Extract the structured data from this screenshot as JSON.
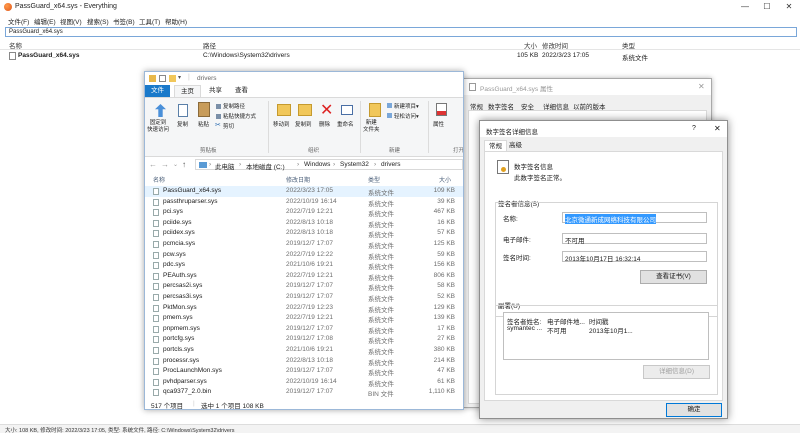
{
  "everything": {
    "title": "PassGuard_x64.sys - Everything",
    "menu": [
      "文件(F)",
      "编辑(E)",
      "视图(V)",
      "搜索(S)",
      "书签(B)",
      "工具(T)",
      "帮助(H)"
    ],
    "search_value": "PassGuard_x64.sys",
    "columns": [
      "名称",
      "路径",
      "大小",
      "修改时间",
      "类型"
    ],
    "result": {
      "name": "PassGuard_x64.sys",
      "path": "C:\\Windows\\System32\\drivers",
      "size": "105 KB",
      "modified": "2022/3/23 17:05",
      "type": "系统文件"
    },
    "status": "大小: 108 KB, 修改时间: 2022/3/23 17:05, 类型: 系统文件, 路径: C:\\Windows\\System32\\drivers"
  },
  "explorer": {
    "title": "drivers",
    "tabs": [
      "文件",
      "主页",
      "共享",
      "查看"
    ],
    "ribbon": {
      "pin": "固定到\n快速访问",
      "copy": "复制",
      "paste": "粘贴",
      "copy_path": "复制路径",
      "paste_shortcut": "粘贴快捷方式",
      "cut": "剪切",
      "clipboard_group": "剪贴板",
      "move_to": "移动到",
      "copy_to": "复制到",
      "delete": "删除",
      "rename": "重命名",
      "organize_group": "组织",
      "new_item": "新建项目▾",
      "easy_access": "轻松访问▾",
      "new_folder": "新建\n文件夹",
      "new_group": "新建",
      "properties": "属性",
      "open_group": "打开"
    },
    "breadcrumbs": [
      "此电脑",
      "本地磁盘 (C:)",
      "Windows",
      "System32",
      "drivers"
    ],
    "list_headers": [
      "名称",
      "修改日期",
      "类型",
      "大小"
    ],
    "files": [
      {
        "name": "PassGuard_x64.sys",
        "date": "2022/3/23 17:05",
        "type": "系统文件",
        "size": "109 KB"
      },
      {
        "name": "passthruparser.sys",
        "date": "2022/10/19 16:14",
        "type": "系统文件",
        "size": "39 KB"
      },
      {
        "name": "pci.sys",
        "date": "2022/7/19 12:21",
        "type": "系统文件",
        "size": "467 KB"
      },
      {
        "name": "pciide.sys",
        "date": "2022/8/13 10:18",
        "type": "系统文件",
        "size": "16 KB"
      },
      {
        "name": "pciidex.sys",
        "date": "2022/8/13 10:18",
        "type": "系统文件",
        "size": "57 KB"
      },
      {
        "name": "pcmcia.sys",
        "date": "2019/12/7 17:07",
        "type": "系统文件",
        "size": "125 KB"
      },
      {
        "name": "pcw.sys",
        "date": "2022/7/19 12:22",
        "type": "系统文件",
        "size": "59 KB"
      },
      {
        "name": "pdc.sys",
        "date": "2021/10/6 19:21",
        "type": "系统文件",
        "size": "156 KB"
      },
      {
        "name": "PEAuth.sys",
        "date": "2022/7/19 12:21",
        "type": "系统文件",
        "size": "806 KB"
      },
      {
        "name": "percsas2i.sys",
        "date": "2019/12/7 17:07",
        "type": "系统文件",
        "size": "58 KB"
      },
      {
        "name": "percsas3i.sys",
        "date": "2019/12/7 17:07",
        "type": "系统文件",
        "size": "52 KB"
      },
      {
        "name": "PktMon.sys",
        "date": "2022/7/19 12:23",
        "type": "系统文件",
        "size": "129 KB"
      },
      {
        "name": "pmem.sys",
        "date": "2022/7/19 12:21",
        "type": "系统文件",
        "size": "139 KB"
      },
      {
        "name": "pnpmem.sys",
        "date": "2019/12/7 17:07",
        "type": "系统文件",
        "size": "17 KB"
      },
      {
        "name": "portcfg.sys",
        "date": "2019/12/7 17:08",
        "type": "系统文件",
        "size": "27 KB"
      },
      {
        "name": "portcls.sys",
        "date": "2021/10/6 19:21",
        "type": "系统文件",
        "size": "380 KB"
      },
      {
        "name": "processr.sys",
        "date": "2022/8/13 10:18",
        "type": "系统文件",
        "size": "214 KB"
      },
      {
        "name": "ProcLaunchMon.sys",
        "date": "2019/12/7 17:07",
        "type": "系统文件",
        "size": "47 KB"
      },
      {
        "name": "pvhdparser.sys",
        "date": "2022/10/19 16:14",
        "type": "系统文件",
        "size": "61 KB"
      },
      {
        "name": "qca9377_2.0.bin",
        "date": "2019/12/7 17:07",
        "type": "BIN 文件",
        "size": "1,110 KB"
      }
    ],
    "status_count": "517 个项目",
    "status_selected": "选中 1 个项目 108 KB"
  },
  "properties": {
    "title": "PassGuard_x64.sys 属性",
    "tabs": [
      "常规",
      "数字签名",
      "安全",
      "详细信息",
      "以前的版本"
    ]
  },
  "dialog": {
    "title": "数字签名详细信息",
    "help": "?",
    "close": "✕",
    "tabs": [
      "常规",
      "高级"
    ],
    "sig_heading": "数字签名信息",
    "sig_status": "此数字签名正常。",
    "signer_group": "签名者信息(S)",
    "name_label": "名称:",
    "name_value": "北京微通新成网络科技有限公司",
    "email_label": "电子邮件:",
    "email_value": "不可用",
    "time_label": "签名时间:",
    "time_value": "2013年10月17日 16:32:14",
    "view_cert": "查看证书(V)",
    "counter_group": "副署(U)",
    "counter_headers": [
      "签名者姓名:",
      "电子邮件地...",
      "时间戳"
    ],
    "counter_row": [
      "symantec ...",
      "不可用",
      "2013年10月1..."
    ],
    "details_button": "详细信息(D)",
    "ok": "确定"
  }
}
